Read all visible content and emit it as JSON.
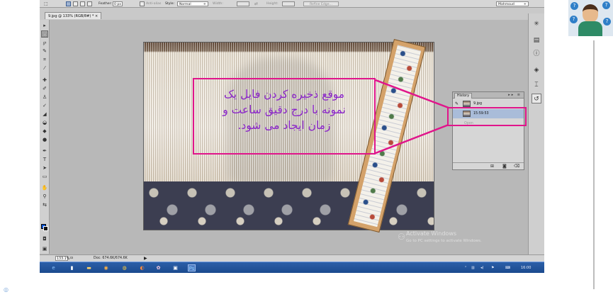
{
  "options_bar": {
    "feather_label": "Feather:",
    "feather_value": "0 px",
    "antialias_label": "Anti-alias",
    "style_label": "Style:",
    "style_value": "Normal",
    "width_label": "Width:",
    "height_label": "Height:",
    "refine_edge_label": "Refine Edge...",
    "workspace_value": "Mahmoud"
  },
  "document": {
    "tab_title": "9.jpg @ 133% (RGB/8#) * ×"
  },
  "callout": {
    "text": "موقع ذخیره کردن فایل یک\nنمونه با درج دقیق ساعت و\nزمان ایجاد می شود.",
    "color": "#e0158b"
  },
  "history_panel": {
    "title": "History",
    "controls": "▸▸ ≡",
    "items": [
      {
        "label": "9.jpg",
        "selected": false
      },
      {
        "label": "15:59:53",
        "selected": true
      },
      {
        "label": "Open",
        "selected": false
      }
    ]
  },
  "status_bar": {
    "zoom": "133.1%",
    "doc_info": "Doc: 674.6K/674.6K"
  },
  "watermark": {
    "title": "Activate Windows",
    "subtitle": "Go to PC settings to activate Windows."
  },
  "taskbar": {
    "clock": "16:00"
  }
}
